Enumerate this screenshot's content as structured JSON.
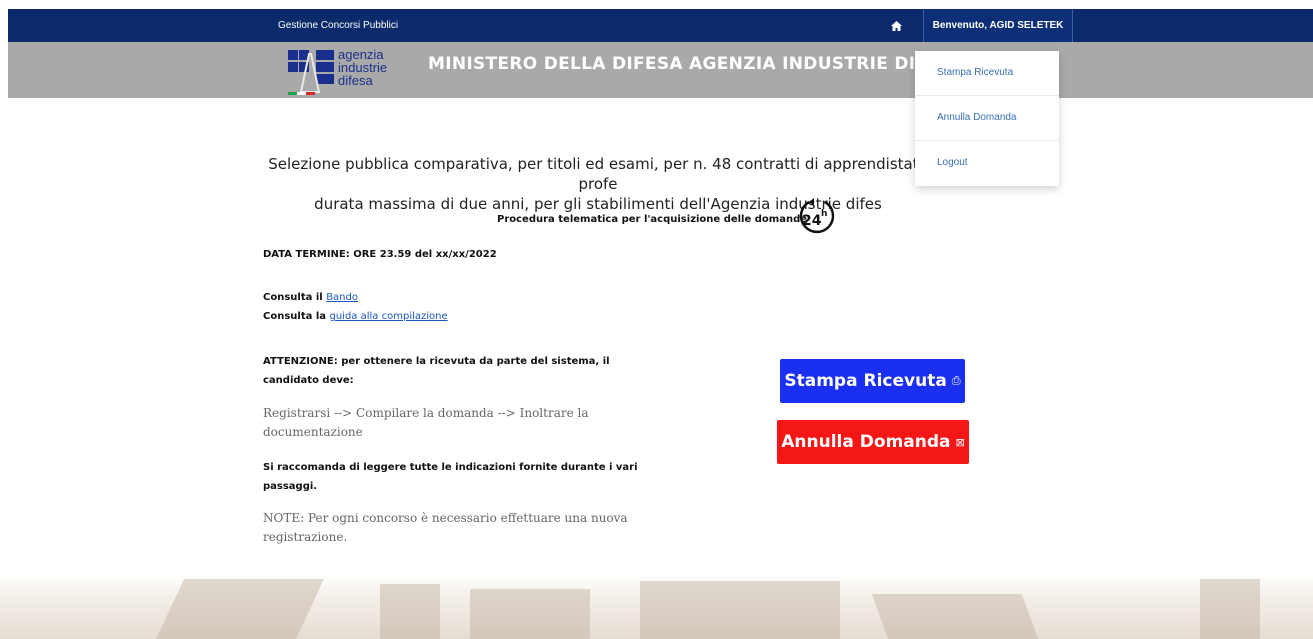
{
  "topnav": {
    "brand": "Gestione Concorsi Pubblici",
    "home_icon": "home-icon",
    "welcome": "Benvenuto, AGID SELETEK"
  },
  "header": {
    "logo_lines": [
      "agenzia",
      "industrie",
      "difesa"
    ],
    "title": "MINISTERO DELLA DIFESA AGENZIA INDUSTRIE DIFESA DIREZ"
  },
  "dropdown": {
    "items": [
      "Stampa Ricevuta",
      "Annulla Domanda",
      "Logout"
    ]
  },
  "main": {
    "intro_line1": "Selezione pubblica comparativa, per titoli ed esami, per n. 48 contratti di apprendistato profe",
    "intro_line2": "durata massima di due anni, per gli stabilimenti dell'Agenzia industrie difes",
    "procedura": "Procedura telematica per l'acquisizione delle domande",
    "clock_label": "24h",
    "deadline": "DATA TERMINE: ORE 23.59 del xx/xx/2022",
    "consulta_bando_prefix": "Consulta il",
    "consulta_bando_link": "Bando",
    "consulta_guida_prefix": "Consulta la",
    "consulta_guida_link": "guida alla compilazione",
    "attenzione_bold": "ATTENZIONE:",
    "attenzione_text": " per ottenere la ricevuta da parte del sistema, il candidato deve:",
    "steps": "Registrarsi --> Compilare la domanda --> Inoltrare la documentazione",
    "raccomanda": "Si raccomanda di leggere tutte le indicazioni fornite durante i vari passaggi.",
    "note": "NOTE: Per ogni concorso è necessario effettuare una nuova registrazione."
  },
  "buttons": {
    "print_label": "Stampa Ricevuta",
    "print_icon": "print-icon",
    "cancel_label": "Annulla Domanda",
    "cancel_icon": "close-box-icon",
    "print_color": "#1b2ff0",
    "cancel_color": "#f51616"
  },
  "colors": {
    "nav_bg": "#0a2a6b",
    "header_bg": "#a9a9a9",
    "link": "#1a56c4"
  }
}
